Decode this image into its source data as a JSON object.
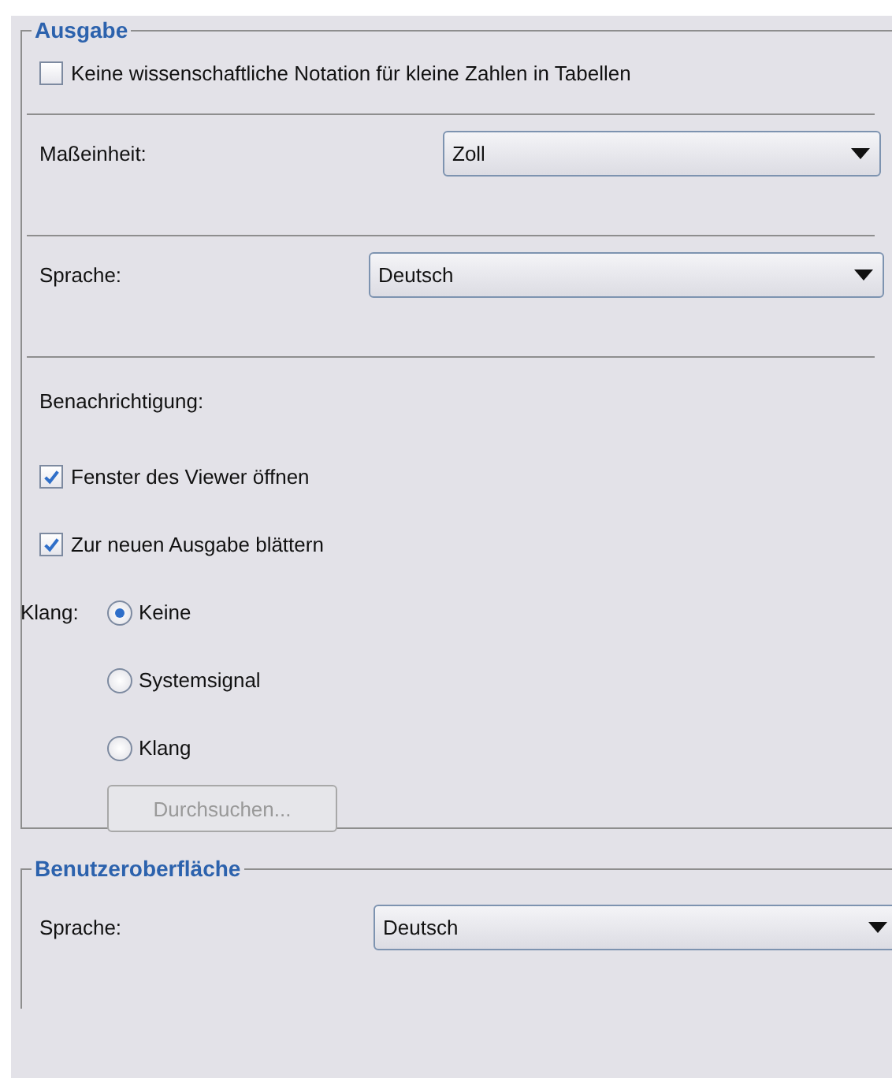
{
  "groups": [
    {
      "title": "Ausgabe",
      "sections": [
        {
          "kind": "checkbox",
          "items": [
            {
              "label": "Keine wissenschaftliche Notation für kleine Zahlen in Tabellen",
              "checked": false
            }
          ]
        },
        {
          "kind": "select",
          "label": "Maßeinheit:",
          "value": "Zoll"
        },
        {
          "kind": "select",
          "label": "Sprache:",
          "value": "Deutsch"
        },
        {
          "kind": "notification",
          "label": "Benachrichtigung:",
          "checkboxes": [
            {
              "label": "Fenster des Viewer öffnen",
              "checked": true
            },
            {
              "label": "Zur neuen Ausgabe blättern",
              "checked": true
            }
          ],
          "sound_label": "Klang:",
          "radios": [
            {
              "label": "Keine",
              "selected": true
            },
            {
              "label": "Systemsignal",
              "selected": false
            },
            {
              "label": "Klang",
              "selected": false
            }
          ],
          "browse_button": {
            "label": "Durchsuchen...",
            "disabled": true
          }
        }
      ]
    },
    {
      "title": "Benutzeroberfläche",
      "sections": [
        {
          "kind": "select",
          "label": "Sprache:",
          "value": "Deutsch"
        }
      ]
    }
  ]
}
